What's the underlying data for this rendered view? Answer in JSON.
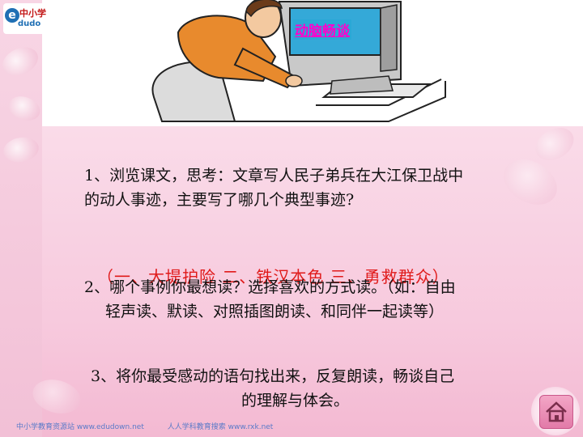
{
  "logo": {
    "mark": "e",
    "cn_text": "中小学",
    "en_text": "dudo"
  },
  "header": {
    "title_link": "动脑畅谈"
  },
  "questions": {
    "q1_line1": "1、浏览课文，思考：文章写人民子弟兵在大江保卫战中",
    "q1_line2": "的动人事迹，主要写了哪几个典型事迹?",
    "q2_line1": "2、哪个事例你最想读？选择喜欢的方式读。（如：自由",
    "q2_line2": "轻声读、默读、对照插图朗读、和同伴一起读等）",
    "q3_line1": "3、将你最受感动的语句找出来，反复朗读，畅谈自己",
    "q3_line2": "的理解与体会。"
  },
  "answer": {
    "text": "（一、大堤护险  二、铁汉本色  三、勇救群众）"
  },
  "footer": {
    "left": "中小学教育资源站 www.edudown.net",
    "right": "人人学科教育搜索 www.rxk.net"
  },
  "colors": {
    "title_link": "#ff00cc",
    "answer": "#e01a1a",
    "background": "#f7c9dd"
  },
  "icons": {
    "home": "home-icon"
  }
}
